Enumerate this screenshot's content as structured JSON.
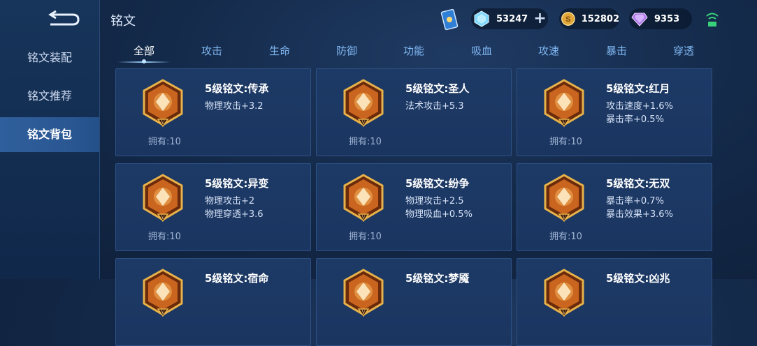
{
  "header": {
    "title": "铭文"
  },
  "sidebar": {
    "items": [
      {
        "label": "铭文装配",
        "active": false
      },
      {
        "label": "铭文推荐",
        "active": false
      },
      {
        "label": "铭文背包",
        "active": true
      }
    ]
  },
  "resources": {
    "crystal": "53247",
    "gold": "152802",
    "diamond": "9353",
    "plus": "+"
  },
  "tabs": [
    {
      "label": "全部",
      "active": true
    },
    {
      "label": "攻击"
    },
    {
      "label": "生命"
    },
    {
      "label": "防御"
    },
    {
      "label": "功能"
    },
    {
      "label": "吸血"
    },
    {
      "label": "攻速"
    },
    {
      "label": "暴击"
    },
    {
      "label": "穿透"
    }
  ],
  "cards": [
    {
      "name": "5级铭文:传承",
      "stats": [
        "物理攻击+3.2"
      ],
      "owned": "拥有:10",
      "icon": "pillar-emblem-icon",
      "color": "#c9651f"
    },
    {
      "name": "5级铭文:圣人",
      "stats": [
        "法术攻击+5.3"
      ],
      "owned": "拥有:10",
      "icon": "blossom-emblem-icon",
      "color": "#c9651f"
    },
    {
      "name": "5级铭文:红月",
      "stats": [
        "攻击速度+1.6%",
        "暴击率+0.5%"
      ],
      "owned": "拥有:10",
      "icon": "moon-emblem-icon",
      "color": "#c9651f"
    },
    {
      "name": "5级铭文:异变",
      "stats": [
        "物理攻击+2",
        "物理穿透+3.6"
      ],
      "owned": "拥有:10",
      "icon": "helmet-emblem-icon",
      "color": "#c9651f"
    },
    {
      "name": "5级铭文:纷争",
      "stats": [
        "物理攻击+2.5",
        "物理吸血+0.5%"
      ],
      "owned": "拥有:10",
      "icon": "sword-emblem-icon",
      "color": "#c9651f"
    },
    {
      "name": "5级铭文:无双",
      "stats": [
        "暴击率+0.7%",
        "暴击效果+3.6%"
      ],
      "owned": "拥有:10",
      "icon": "diamond-emblem-icon",
      "color": "#c9651f"
    },
    {
      "name": "5级铭文:宿命",
      "stats": [],
      "owned": "",
      "icon": "emblem-icon",
      "color": "#c9651f"
    },
    {
      "name": "5级铭文:梦魇",
      "stats": [],
      "owned": "",
      "icon": "emblem-icon",
      "color": "#c9651f"
    },
    {
      "name": "5级铭文:凶兆",
      "stats": [],
      "owned": "",
      "icon": "emblem-icon",
      "color": "#c9651f"
    }
  ]
}
